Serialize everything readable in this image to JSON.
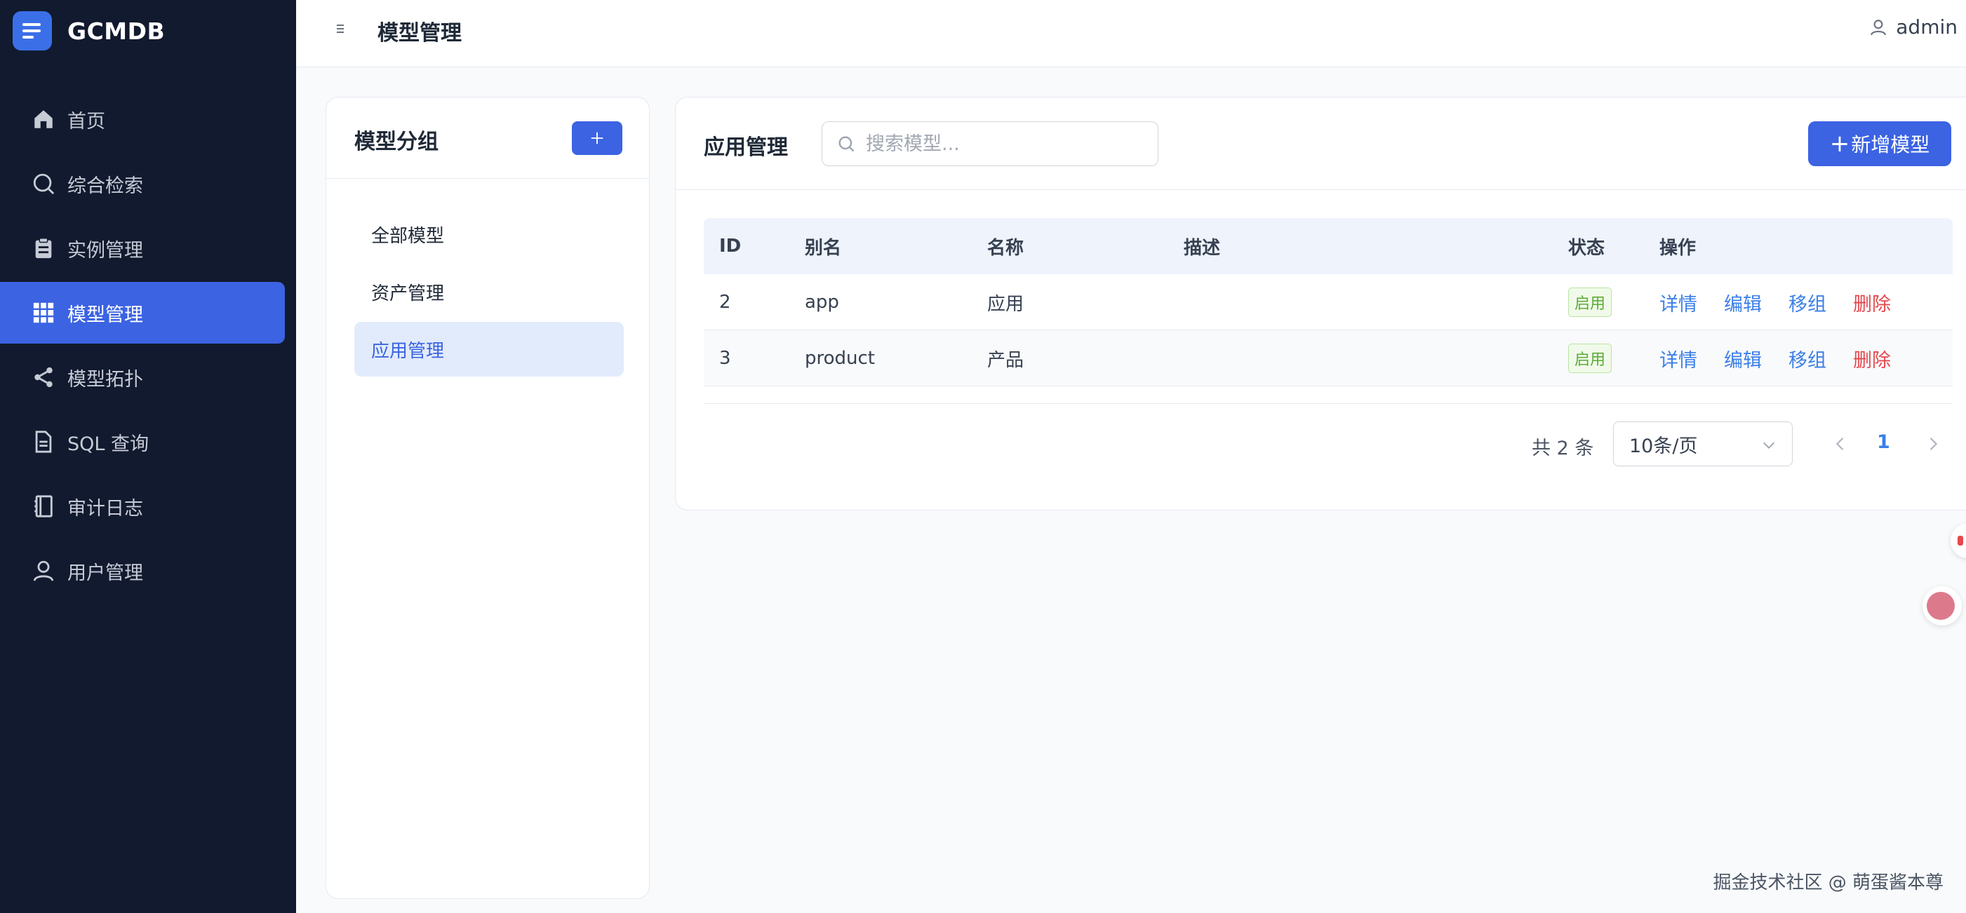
{
  "brand": {
    "name": "GCMDB"
  },
  "sidebar": {
    "items": [
      {
        "label": "首页",
        "icon": "home-icon"
      },
      {
        "label": "综合检索",
        "icon": "search-icon"
      },
      {
        "label": "实例管理",
        "icon": "clipboard-icon"
      },
      {
        "label": "模型管理",
        "icon": "grid-icon",
        "active": true
      },
      {
        "label": "模型拓扑",
        "icon": "share-icon"
      },
      {
        "label": "SQL 查询",
        "icon": "document-icon"
      },
      {
        "label": "审计日志",
        "icon": "notebook-icon"
      },
      {
        "label": "用户管理",
        "icon": "user-icon"
      }
    ]
  },
  "header": {
    "title": "模型管理",
    "user": "admin"
  },
  "groups": {
    "title": "模型分组",
    "items": [
      {
        "label": "全部模型"
      },
      {
        "label": "资产管理"
      },
      {
        "label": "应用管理",
        "active": true
      }
    ]
  },
  "main": {
    "title": "应用管理",
    "search_placeholder": "搜索模型...",
    "add_label": "新增模型",
    "columns": [
      "ID",
      "别名",
      "名称",
      "描述",
      "状态",
      "操作"
    ],
    "rows": [
      {
        "id": "2",
        "alias": "app",
        "name": "应用",
        "desc": "",
        "status": "启用"
      },
      {
        "id": "3",
        "alias": "product",
        "name": "产品",
        "desc": "",
        "status": "启用"
      }
    ],
    "actions": {
      "detail": "详情",
      "edit": "编辑",
      "move": "移组",
      "delete": "删除"
    }
  },
  "pagination": {
    "total": "共 2 条",
    "page_size": "10条/页",
    "current": "1"
  },
  "watermark": "掘金技术社区 @ 萌蛋酱本尊",
  "colors": {
    "sidebar_bg": "#111a2e",
    "primary": "#3b63e2",
    "link": "#3b7fe8",
    "danger": "#e5484d",
    "success": "#5aab36"
  }
}
